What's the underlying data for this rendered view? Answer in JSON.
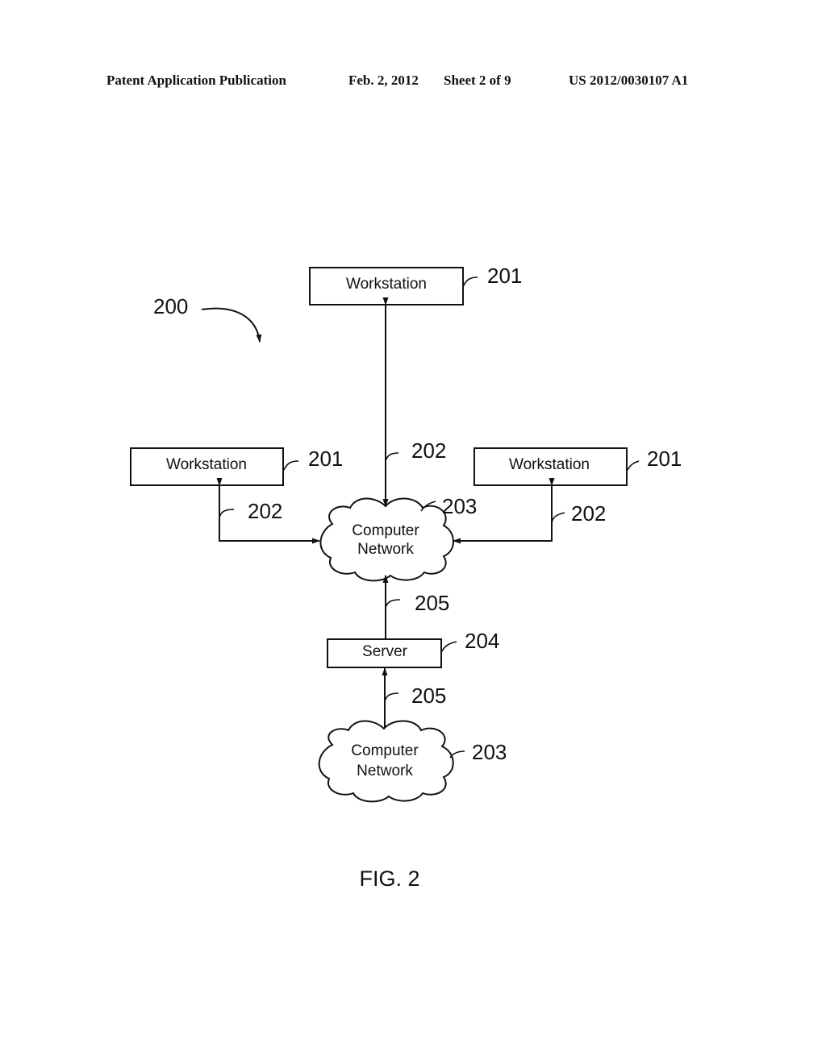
{
  "header": {
    "publication": "Patent Application Publication",
    "date": "Feb. 2, 2012",
    "sheet": "Sheet 2 of 9",
    "number": "US 2012/0030107 A1"
  },
  "diagram": {
    "system_ref": "200",
    "workstations": [
      {
        "label": "Workstation",
        "ref": "201",
        "link_ref": "202",
        "position": "top"
      },
      {
        "label": "Workstation",
        "ref": "201",
        "link_ref": "202",
        "position": "left"
      },
      {
        "label": "Workstation",
        "ref": "201",
        "link_ref": "202",
        "position": "right"
      }
    ],
    "networks": [
      {
        "label_line1": "Computer",
        "label_line2": "Network",
        "ref": "203"
      },
      {
        "label_line1": "Computer",
        "label_line2": "Network",
        "ref": "203"
      }
    ],
    "server": {
      "label": "Server",
      "ref": "204"
    },
    "server_links": [
      {
        "ref": "205",
        "from": "server",
        "to": "network-upper"
      },
      {
        "ref": "205",
        "from": "network-lower",
        "to": "server"
      }
    ]
  },
  "caption": "FIG. 2"
}
